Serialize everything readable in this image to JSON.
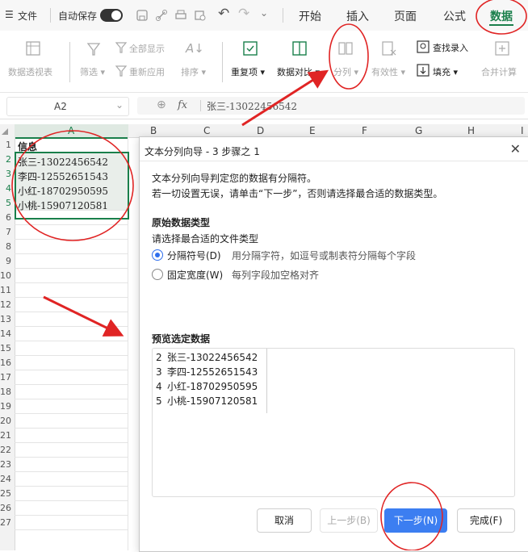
{
  "menubar": {
    "file_label": "文件",
    "autosave_label": "自动保存",
    "tabs": [
      "开始",
      "插入",
      "页面",
      "公式",
      "数据"
    ]
  },
  "ribbon": {
    "pivot": "数据透视表",
    "filter": "筛选",
    "show_all": "全部显示",
    "reapply": "重新应用",
    "sort": "排序",
    "duplicates": "重复项",
    "compare": "数据对比",
    "split": "分列",
    "validity": "有效性",
    "lookup_entry": "查找录入",
    "fill": "填充",
    "consolidate": "合并计算"
  },
  "formula_bar": {
    "cell_ref": "A2",
    "fx": "fx",
    "content": "张三-13022456542"
  },
  "sheet": {
    "columns": [
      "A",
      "B",
      "C",
      "D",
      "E",
      "F",
      "G",
      "H",
      "I"
    ],
    "rows": [
      "1",
      "2",
      "3",
      "4",
      "5",
      "6",
      "7",
      "8",
      "9",
      "10",
      "11",
      "12",
      "13",
      "14",
      "15",
      "16",
      "17",
      "18",
      "19",
      "20",
      "21",
      "22",
      "23",
      "24",
      "25",
      "26",
      "27"
    ],
    "cells": [
      "信息",
      "张三-13022456542",
      "李四-12552651543",
      "小红-18702950595",
      "小桃-15907120581"
    ]
  },
  "dialog": {
    "title": "文本分列向导 - 3 步骤之 1",
    "intro1": "文本分列向导判定您的数据有分隔符。",
    "intro2": "若一切设置无误，请单击“下一步”，否则请选择最合适的数据类型。",
    "section_title": "原始数据类型",
    "section_sub": "请选择最合适的文件类型",
    "opt1_label": "分隔符号(D)",
    "opt1_desc": "用分隔字符，如逗号或制表符分隔每个字段",
    "opt2_label": "固定宽度(W)",
    "opt2_desc": "每列字段加空格对齐",
    "preview_title": "预览选定数据",
    "preview_lines": [
      {
        "num": "2",
        "text": "张三-13022456542"
      },
      {
        "num": "3",
        "text": "李四-12552651543"
      },
      {
        "num": "4",
        "text": "小红-18702950595"
      },
      {
        "num": "5",
        "text": "小桃-15907120581"
      }
    ],
    "buttons": {
      "cancel": "取消",
      "prev": "上一步(B)",
      "next": "下一步(N)",
      "finish": "完成(F)"
    }
  },
  "colors": {
    "accent_green": "#1a7f4b",
    "primary_blue": "#3c7ef1",
    "annotation_red": "#e02424"
  }
}
